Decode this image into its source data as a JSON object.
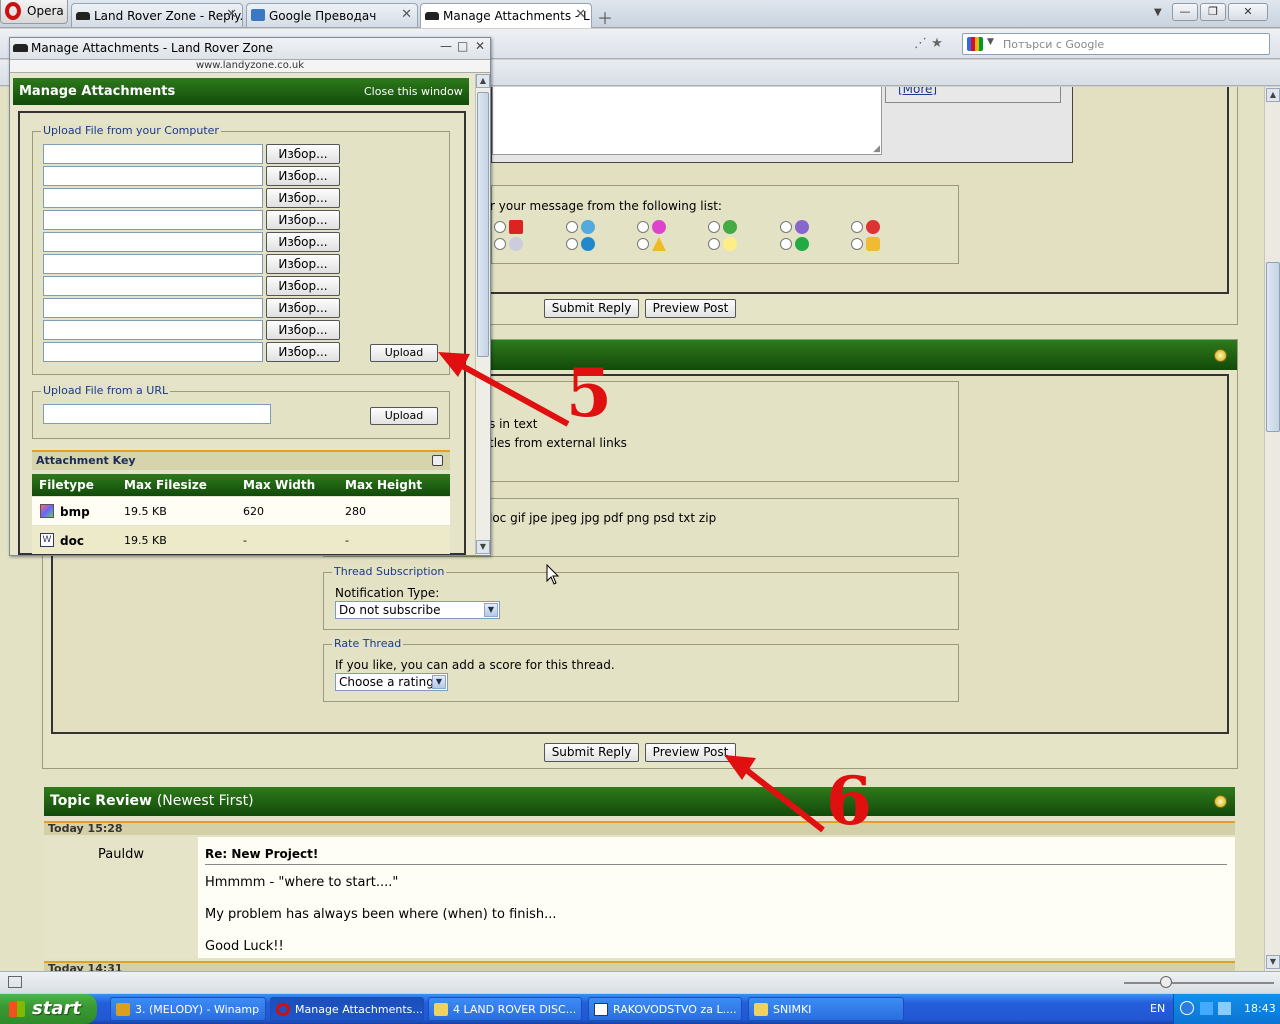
{
  "browser": {
    "menu_label": "Opera",
    "tabs": [
      {
        "label": "Land Rover Zone - Reply..."
      },
      {
        "label": "Google Преводач"
      },
      {
        "label": "Manage Attachments - L..."
      }
    ],
    "search_placeholder": "Потърси с Google"
  },
  "popup": {
    "window_title": "Manage Attachments - Land Rover Zone",
    "url": "www.landyzone.co.uk",
    "header_title": "Manage Attachments",
    "close_link": "Close this window",
    "upload_computer_legend": "Upload File from your Computer",
    "browse_label": "Избор...",
    "upload_label": "Upload",
    "upload_url_legend": "Upload File from a URL",
    "attachment_key": {
      "title": "Attachment Key",
      "columns": [
        "Filetype",
        "Max Filesize",
        "Max Width",
        "Max Height"
      ],
      "rows": [
        {
          "type": "bmp",
          "size": "19.5 KB",
          "width": "620",
          "height": "280"
        },
        {
          "type": "doc",
          "size": "19.5 KB",
          "width": "-",
          "height": "-"
        }
      ]
    }
  },
  "page": {
    "more_link": "[More]",
    "icon_prompt": "r your message from the following list:",
    "submit_reply": "Submit Reply",
    "preview_post": "Preview Post",
    "options_line1": "s in text",
    "options_line2": "tles from external links",
    "attach_types": "loc gif jpe jpeg jpg pdf png psd txt zip",
    "thread_subscription": {
      "legend": "Thread Subscription",
      "label": "Notification Type:",
      "value": "Do not subscribe"
    },
    "rate_thread": {
      "legend": "Rate Thread",
      "label": "If you like, you can add a score for this thread.",
      "value": "Choose a rating"
    },
    "topic_review": {
      "title": "Topic Review",
      "subtitle": "(Newest First)",
      "date1": "Today 15:28",
      "author": "Pauldw",
      "post_title": "Re: New Project!",
      "line1": "Hmmmm - \"where to start....\"",
      "line2": "My problem has always been where (when) to finish...",
      "line3": "Good Luck!!",
      "date2": "Today 14:31"
    }
  },
  "annotations": {
    "step5": "5",
    "step6": "6"
  },
  "taskbar": {
    "start": "start",
    "items": [
      {
        "label": "3.  (MELODY) - Winamp"
      },
      {
        "label": "Manage Attachments..."
      },
      {
        "label": "4 LAND ROVER DISC..."
      },
      {
        "label": "RAKOVODSTVO za L...."
      },
      {
        "label": "SNIMKI"
      }
    ],
    "lang": "EN",
    "clock": "18:43"
  }
}
